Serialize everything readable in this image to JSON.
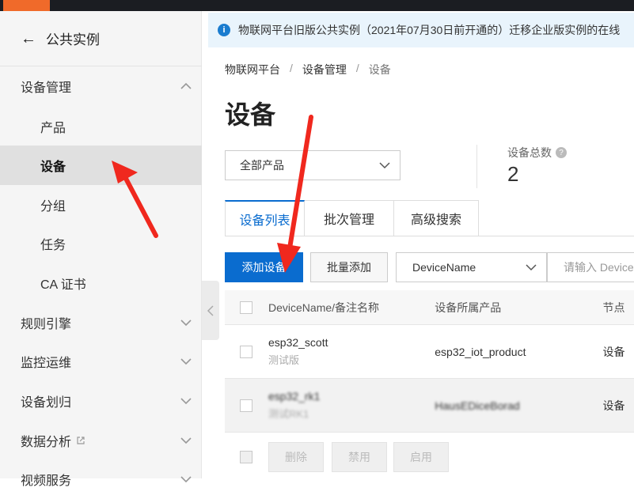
{
  "sidebar": {
    "back_label": "公共实例",
    "items": [
      {
        "label": "设备管理",
        "level": 1,
        "expanded": true
      },
      {
        "label": "产品",
        "level": 2
      },
      {
        "label": "设备",
        "level": 2,
        "active": true
      },
      {
        "label": "分组",
        "level": 2
      },
      {
        "label": "任务",
        "level": 2
      },
      {
        "label": "CA 证书",
        "level": 2
      },
      {
        "label": "规则引擎",
        "level": 1
      },
      {
        "label": "监控运维",
        "level": 1
      },
      {
        "label": "设备划归",
        "level": 1
      },
      {
        "label": "数据分析",
        "level": 1,
        "external": true
      },
      {
        "label": "视频服务",
        "level": 1
      }
    ]
  },
  "notice": {
    "text": "物联网平台旧版公共实例（2021年07月30日前开通的）迁移企业版实例的在线"
  },
  "breadcrumb": [
    "物联网平台",
    "设备管理",
    "设备"
  ],
  "page": {
    "title": "设备"
  },
  "product_select": {
    "value": "全部产品"
  },
  "stats": {
    "total_label": "设备总数",
    "total_value": "2"
  },
  "tabs": [
    "设备列表",
    "批次管理",
    "高级搜索"
  ],
  "toolbar": {
    "add_device": "添加设备",
    "batch_add": "批量添加",
    "filter_field": "DeviceName",
    "search_placeholder": "请输入 DeviceName"
  },
  "table": {
    "headers": [
      "DeviceName/备注名称",
      "设备所属产品",
      "节点"
    ],
    "rows": [
      {
        "name": "esp32_scott",
        "note": "测试版",
        "product": "esp32_iot_product",
        "node": "设备"
      },
      {
        "name": "esp32_rk1",
        "note": "测试RK1",
        "product": "HausEDiceBorad",
        "node": "设备"
      }
    ]
  },
  "footer_actions": [
    "删除",
    "禁用",
    "启用"
  ],
  "colors": {
    "primary": "#0a6ccf",
    "arrow": "#f0281e",
    "brand": "#f06a2a"
  }
}
